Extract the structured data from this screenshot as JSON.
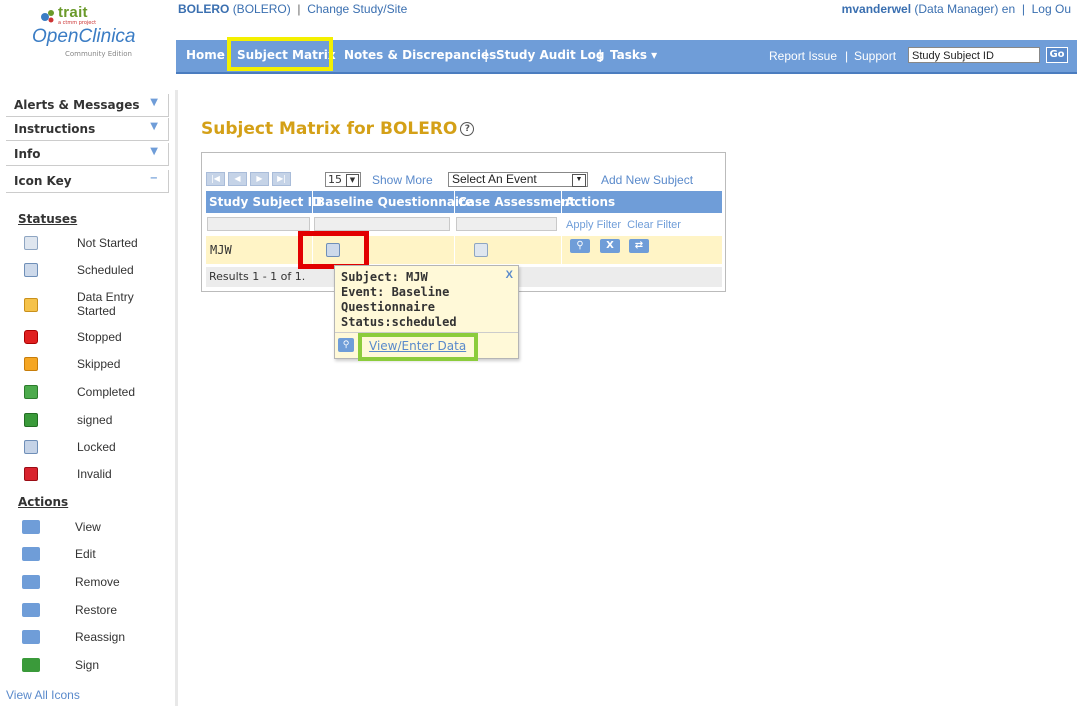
{
  "header": {
    "logo_brand": "trait",
    "logo_tagline": "a ctmm project",
    "logo_product": "OpenClinica",
    "logo_edition": "Community Edition",
    "study_name": "BOLERO",
    "study_code": "(BOLERO)",
    "change_study": "Change Study/Site",
    "username": "mvanderwel",
    "role": "(Data Manager)",
    "language": "en",
    "logout": "Log Ou"
  },
  "nav": {
    "home": "Home",
    "subject_matrix": "Subject Matrix",
    "notes": "Notes & Discrepancies",
    "audit": "Study Audit Log",
    "tasks": "Tasks ▾",
    "report_issue": "Report Issue",
    "support": "Support",
    "search_value": "Study Subject ID",
    "go": "Go"
  },
  "sidebar": {
    "panels": [
      "Alerts & Messages",
      "Instructions",
      "Info",
      "Icon Key"
    ],
    "statuses_title": "Statuses",
    "statuses": [
      {
        "label": "Not Started",
        "icon": "not-started-icon"
      },
      {
        "label": "Scheduled",
        "icon": "scheduled-icon"
      },
      {
        "label": "Data Entry Started",
        "icon": "data-entry-started-icon"
      },
      {
        "label": "Stopped",
        "icon": "stopped-icon"
      },
      {
        "label": "Skipped",
        "icon": "skipped-icon"
      },
      {
        "label": "Completed",
        "icon": "completed-icon"
      },
      {
        "label": "signed",
        "icon": "signed-icon"
      },
      {
        "label": "Locked",
        "icon": "locked-icon"
      },
      {
        "label": "Invalid",
        "icon": "invalid-icon"
      }
    ],
    "actions_title": "Actions",
    "actions": [
      {
        "label": "View",
        "icon": "view-icon"
      },
      {
        "label": "Edit",
        "icon": "edit-icon"
      },
      {
        "label": "Remove",
        "icon": "remove-icon"
      },
      {
        "label": "Restore",
        "icon": "restore-icon"
      },
      {
        "label": "Reassign",
        "icon": "reassign-icon"
      },
      {
        "label": "Sign",
        "icon": "sign-icon"
      }
    ],
    "view_all": "View All Icons"
  },
  "main": {
    "title": "Subject Matrix for BOLERO",
    "page_size": "15",
    "show_more": "Show More",
    "event_select": "Select An Event",
    "add_subject": "Add New Subject",
    "columns": [
      "Study Subject ID",
      "Baseline Questionnaire",
      "Case Assessment",
      "Actions"
    ],
    "apply_filter": "Apply Filter",
    "clear_filter": "Clear Filter",
    "rows": [
      {
        "subject_id": "MJW",
        "baseline": "scheduled",
        "case": "not started"
      }
    ],
    "results": "Results 1 - 1 of 1."
  },
  "popup": {
    "subject": "Subject: MJW",
    "event": "Event: Baseline",
    "event2": "Questionnaire",
    "status": "Status:scheduled",
    "close": "X",
    "link": "View/Enter Data"
  },
  "colors": {
    "nav_blue": "#6f9dd8",
    "title_gold": "#d4a017",
    "highlight_yellow": "#f4f000",
    "highlight_red": "#e20000",
    "highlight_green": "#8ccc3c"
  }
}
